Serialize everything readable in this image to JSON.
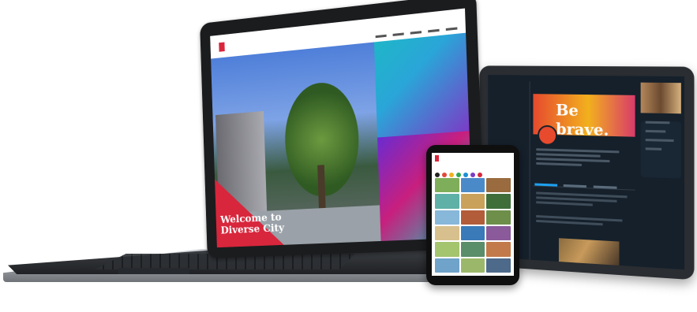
{
  "laptop": {
    "welcome_text": "Welcome to Diverse City",
    "palette": {
      "accent": "#d8263c",
      "tile_cyan": "#1fb6c8",
      "tile_purple": "#6a2bd1"
    }
  },
  "tablet": {
    "banner_text": "Be brave.",
    "palette": {
      "background": "#15202b",
      "link": "#1da1f2"
    }
  },
  "phone": {
    "dot_colors": [
      "#222222",
      "#e04a3a",
      "#f2b01e",
      "#2fa84f",
      "#1b8fd6",
      "#7b3cc6",
      "#d8263c"
    ],
    "tile_colors": [
      "#7fae5a",
      "#4b8ac9",
      "#9a6b3e",
      "#5fb0a6",
      "#c9a15a",
      "#3f6e3a",
      "#87b7d9",
      "#b25c3a",
      "#6d8f4a",
      "#d7c08e",
      "#3a7ab8",
      "#8a5a9a",
      "#a4c46e",
      "#5a8d6a",
      "#c27a4a",
      "#6fa3c9",
      "#9bb86a",
      "#4e6a8a"
    ]
  }
}
